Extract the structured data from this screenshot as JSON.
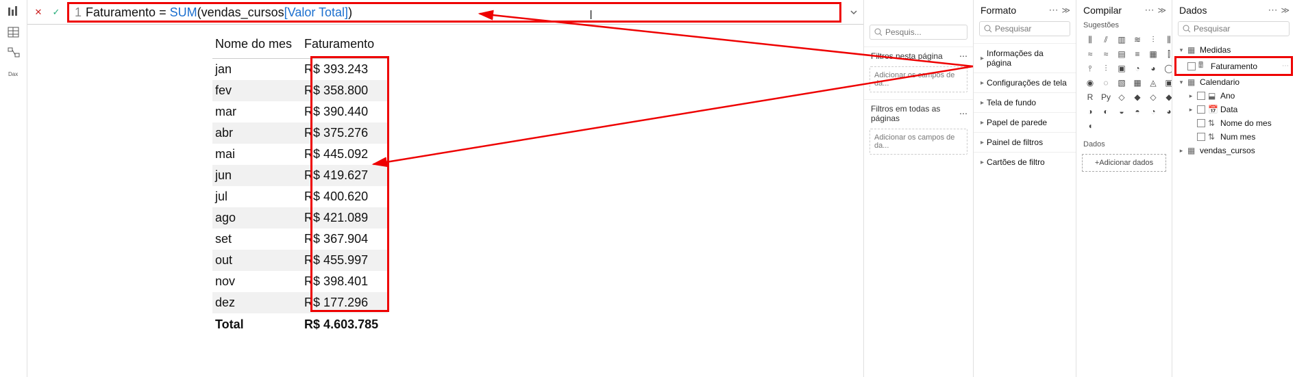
{
  "formula": {
    "line": "1",
    "name": "Faturamento",
    "eq": " = ",
    "fn": "SUM",
    "open": "(",
    "table": "vendas_cursos",
    "col": "[Valor Total]",
    "close": ")"
  },
  "table": {
    "headers": [
      "Nome do mes",
      "Faturamento"
    ],
    "rows": [
      {
        "m": "jan",
        "v": "R$ 393.243"
      },
      {
        "m": "fev",
        "v": "R$ 358.800"
      },
      {
        "m": "mar",
        "v": "R$ 390.440"
      },
      {
        "m": "abr",
        "v": "R$ 375.276"
      },
      {
        "m": "mai",
        "v": "R$ 445.092"
      },
      {
        "m": "jun",
        "v": "R$ 419.627"
      },
      {
        "m": "jul",
        "v": "R$ 400.620"
      },
      {
        "m": "ago",
        "v": "R$ 421.089"
      },
      {
        "m": "set",
        "v": "R$ 367.904"
      },
      {
        "m": "out",
        "v": "R$ 455.997"
      },
      {
        "m": "nov",
        "v": "R$ 398.401"
      },
      {
        "m": "dez",
        "v": "R$ 177.296"
      }
    ],
    "total_label": "Total",
    "total_value": "R$ 4.603.785"
  },
  "filters": {
    "title": "",
    "search_placeholder": "Pesquis...",
    "section1": "Filtros nesta página",
    "add_text": "Adicionar os campos de da...",
    "section2": "Filtros em todas as páginas"
  },
  "format": {
    "title": "Formato",
    "search_placeholder": "Pesquisar",
    "items": [
      "Informações da página",
      "Configurações de tela",
      "Tela de fundo",
      "Papel de parede",
      "Painel de filtros",
      "Cartões de filtro"
    ]
  },
  "build": {
    "title": "Compilar",
    "subtitle": "Sugestões",
    "data_label": "Dados",
    "add_data": "+Adicionar dados"
  },
  "data": {
    "title": "Dados",
    "search_placeholder": "Pesquisar",
    "tree": {
      "medidas": "Medidas",
      "faturamento": "Faturamento",
      "calendario": "Calendario",
      "ano": "Ano",
      "data_field": "Data",
      "nome_mes": "Nome do mes",
      "num_mes": "Num mes",
      "vendas_cursos": "vendas_cursos"
    }
  }
}
